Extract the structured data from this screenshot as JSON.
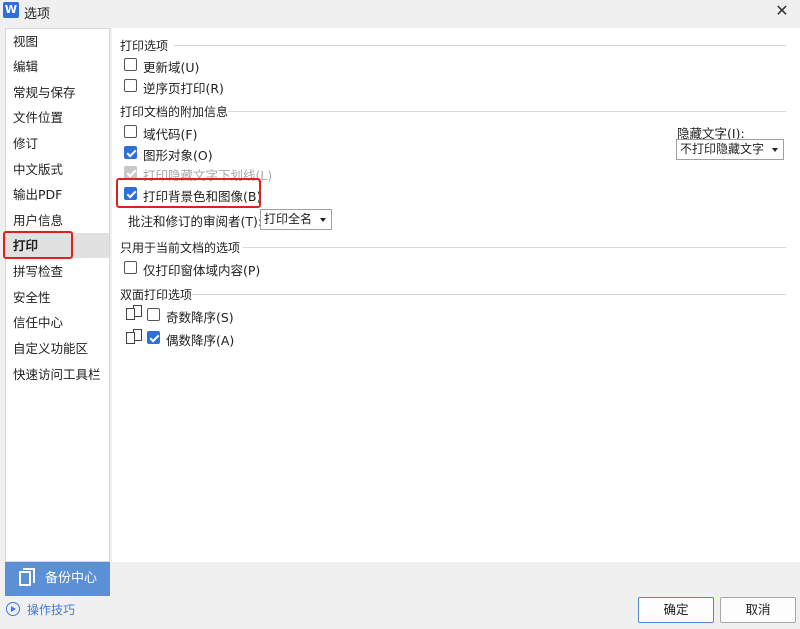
{
  "window": {
    "title": "选项",
    "app_icon_letter": "W",
    "close_glyph": "✕"
  },
  "sidebar": {
    "items": [
      {
        "label": "视图"
      },
      {
        "label": "编辑"
      },
      {
        "label": "常规与保存"
      },
      {
        "label": "文件位置"
      },
      {
        "label": "修订"
      },
      {
        "label": "中文版式"
      },
      {
        "label": "输出PDF"
      },
      {
        "label": "用户信息"
      },
      {
        "label": "打印",
        "active": true
      },
      {
        "label": "拼写检查"
      },
      {
        "label": "安全性"
      },
      {
        "label": "信任中心"
      },
      {
        "label": "自定义功能区"
      },
      {
        "label": "快速访问工具栏"
      }
    ],
    "backup_label": "备份中心",
    "tips_label": "操作技巧"
  },
  "panel": {
    "print_options": {
      "title": "打印选项",
      "update_fields": {
        "label": "更新域(U)",
        "checked": false
      },
      "reverse_order": {
        "label": "逆序页打印(R)",
        "checked": false
      }
    },
    "attached_info": {
      "title": "打印文档的附加信息",
      "field_codes": {
        "label": "域代码(F)",
        "checked": false
      },
      "drawing_objects": {
        "label": "图形对象(O)",
        "checked": true
      },
      "hidden_underline": {
        "label": "打印隐藏文字下划线(L)",
        "checked": true,
        "disabled": true
      },
      "background": {
        "label": "打印背景色和图像(B)",
        "checked": true
      },
      "comments_label": "批注和修订的审阅者(T):",
      "comments_value": "打印全名",
      "hidden_text_label": "隐藏文字(I):",
      "hidden_text_value": "不打印隐藏文字"
    },
    "current_doc": {
      "title": "只用于当前文档的选项",
      "form_data_only": {
        "label": "仅打印窗体域内容(P)",
        "checked": false
      }
    },
    "duplex": {
      "title": "双面打印选项",
      "odd_reverse": {
        "label": "奇数降序(S)",
        "checked": false
      },
      "even_reverse": {
        "label": "偶数降序(A)",
        "checked": true
      }
    }
  },
  "footer": {
    "ok_label": "确定",
    "cancel_label": "取消"
  },
  "colors": {
    "accent": "#2f6fdc",
    "highlight_box": "#e0221f",
    "backup_bg": "#5b8fd6",
    "link": "#3f7ad8"
  }
}
